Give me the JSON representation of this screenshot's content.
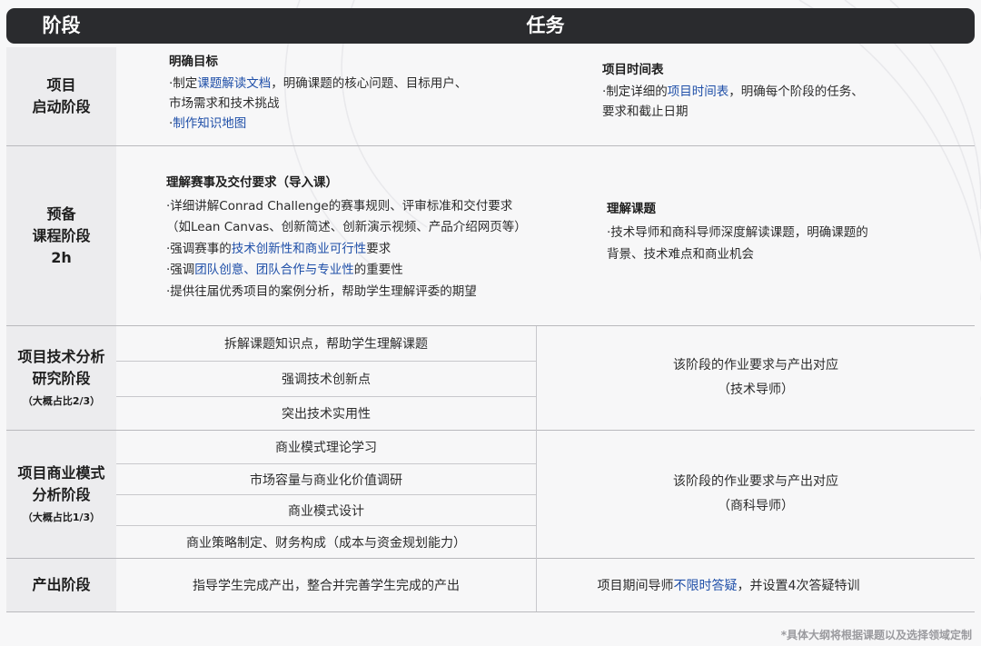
{
  "header": {
    "phase": "阶段",
    "task": "任务"
  },
  "rows": {
    "start": {
      "label_lines": [
        "项目",
        "启动阶段"
      ],
      "left": {
        "title": "明确目标",
        "l1_pre": "·制定",
        "l1_hl": "课题解读文档",
        "l1_post": "，明确课题的核心问题、目标用户、",
        "l2": "市场需求和技术挑战",
        "l3_pre": "·",
        "l3_hl": "制作知识地图"
      },
      "right": {
        "title": "项目时间表",
        "l1_pre": "·制定详细的",
        "l1_hl": "项目时间表",
        "l1_post": "，明确每个阶段的任务、",
        "l2": "要求和截止日期"
      }
    },
    "prep": {
      "label_lines": [
        "预备",
        "课程阶段",
        "2h"
      ],
      "left": {
        "title": "理解赛事及交付要求（导入课）",
        "l1": "·详细讲解Conrad Challenge的赛事规则、评审标准和交付要求",
        "l2": "（如Lean Canvas、创新简述、创新演示视频、产品介绍网页等）",
        "l3_pre": "·强调赛事的",
        "l3_hl": "技术创新性和商业可行性",
        "l3_post": "要求",
        "l4_pre": "·强调",
        "l4_hl": "团队创意、团队合作与专业性",
        "l4_post": "的重要性",
        "l5": "·提供往届优秀项目的案例分析，帮助学生理解评委的期望"
      },
      "right": {
        "title": "理解课题",
        "l1": "·技术导师和商科导师深度解读课题，明确课题的",
        "l2": "背景、技术难点和商业机会"
      }
    },
    "tech": {
      "label_lines": [
        "项目技术分析",
        "研究阶段"
      ],
      "label_sub": "（大概占比2/3）",
      "items": [
        "拆解课题知识点，帮助学生理解课题",
        "强调技术创新点",
        "突出技术实用性"
      ],
      "right_lines": [
        "该阶段的作业要求与产出对应",
        "（技术导师）"
      ]
    },
    "biz": {
      "label_lines": [
        "项目商业模式",
        "分析阶段"
      ],
      "label_sub": "（大概占比1/3）",
      "items": [
        "商业模式理论学习",
        "市场容量与商业化价值调研",
        "商业模式设计",
        "商业策略制定、财务构成（成本与资金规划能力）"
      ],
      "right_lines": [
        "该阶段的作业要求与产出对应",
        "（商科导师）"
      ]
    },
    "output": {
      "label": "产出阶段",
      "left": "指导学生完成产出，整合并完善学生完成的产出",
      "right_pre": "项目期间导师",
      "right_hl": "不限时答疑",
      "right_post": "，并设置4次答疑特训"
    }
  },
  "footer": "*具体大纲将根据课题以及选择领域定制"
}
